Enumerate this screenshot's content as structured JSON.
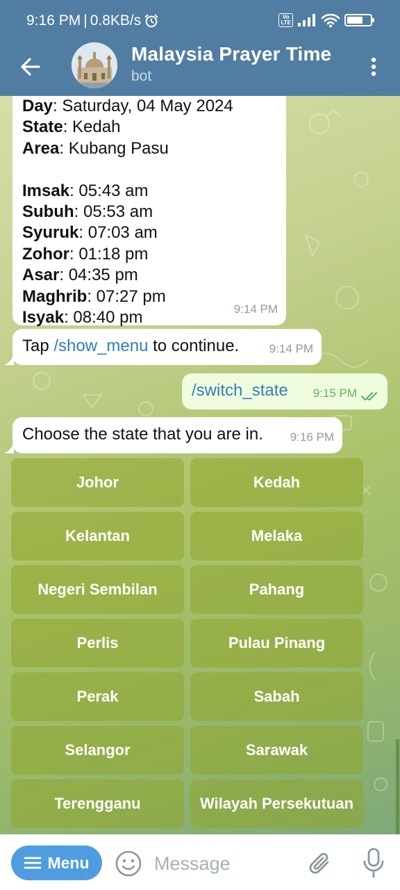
{
  "status_bar": {
    "time": "9:16 PM",
    "speed": "0.8KB/s",
    "volte_line1": "Vo",
    "volte_line2": "LTE",
    "battery_level": 0.7
  },
  "header": {
    "title": "Malaysia Prayer Time",
    "subtitle": "bot",
    "accent_color": "#517da2"
  },
  "prayer_info": {
    "lines": [
      {
        "key": "Day",
        "value": ": Saturday, 04 May 2024"
      },
      {
        "key": "State",
        "value": ": Kedah"
      },
      {
        "key": "Area",
        "value": ": Kubang Pasu"
      },
      {
        "key": "Imsak",
        "value": ": 05:43 am"
      },
      {
        "key": "Subuh",
        "value": ": 05:53 am"
      },
      {
        "key": "Syuruk",
        "value": ": 07:03 am"
      },
      {
        "key": "Zohor",
        "value": ": 01:18 pm"
      },
      {
        "key": "Asar",
        "value": ": 04:35 pm"
      },
      {
        "key": "Maghrib",
        "value": ": 07:27 pm"
      },
      {
        "key": "Isyak",
        "value": ": 08:40 pm"
      }
    ],
    "time": "9:14 PM"
  },
  "continue_message": {
    "prefix": "Tap ",
    "command": "/show_menu",
    "suffix": " to continue.",
    "time": "9:14 PM"
  },
  "outgoing_message": {
    "text": "/switch_state",
    "time": "9:15 PM"
  },
  "choose_message": {
    "text": "Choose the state that you are in.",
    "time": "9:16 PM"
  },
  "keyboard": {
    "buttons": [
      [
        "Johor",
        "Kedah"
      ],
      [
        "Kelantan",
        "Melaka"
      ],
      [
        "Negeri Sembilan",
        "Pahang"
      ],
      [
        "Perlis",
        "Pulau Pinang"
      ],
      [
        "Perak",
        "Sabah"
      ],
      [
        "Selangor",
        "Sarawak"
      ],
      [
        "Terengganu",
        "Wilayah Persekutuan"
      ]
    ]
  },
  "input_bar": {
    "menu_label": "Menu",
    "placeholder": "Message",
    "menu_color": "#4f9de0"
  }
}
